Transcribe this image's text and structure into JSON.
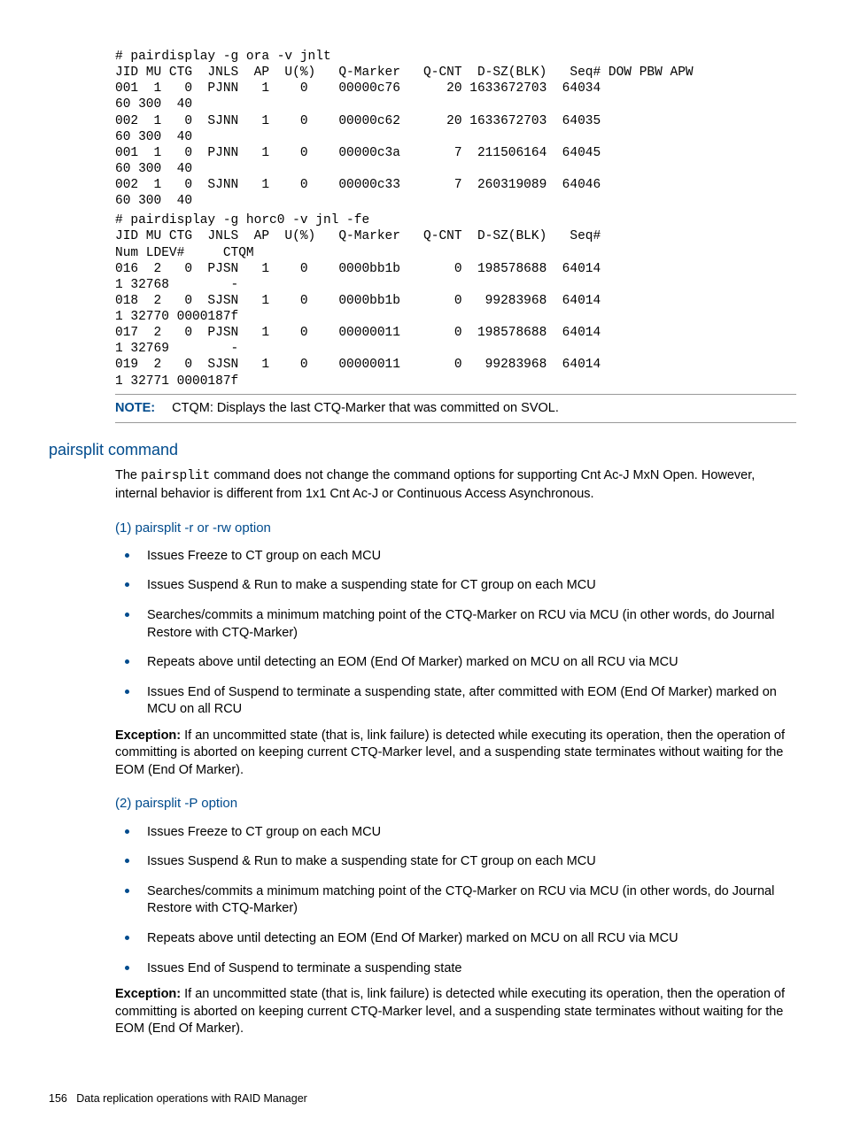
{
  "codeblock1": "# pairdisplay -g ora -v jnlt\nJID MU CTG  JNLS  AP  U(%)   Q-Marker   Q-CNT  D-SZ(BLK)   Seq# DOW PBW APW\n001  1   0  PJNN   1    0    00000c76      20 1633672703  64034\n60 300  40\n002  1   0  SJNN   1    0    00000c62      20 1633672703  64035\n60 300  40\n001  1   0  PJNN   1    0    00000c3a       7  211506164  64045\n60 300  40\n002  1   0  SJNN   1    0    00000c33       7  260319089  64046\n60 300  40",
  "codeblock2": "# pairdisplay -g horc0 -v jnl -fe\nJID MU CTG  JNLS  AP  U(%)   Q-Marker   Q-CNT  D-SZ(BLK)   Seq#\nNum LDEV#     CTQM\n016  2   0  PJSN   1    0    0000bb1b       0  198578688  64014\n1 32768        -\n018  2   0  SJSN   1    0    0000bb1b       0   99283968  64014\n1 32770 0000187f\n017  2   0  PJSN   1    0    00000011       0  198578688  64014\n1 32769        -\n019  2   0  SJSN   1    0    00000011       0   99283968  64014\n1 32771 0000187f",
  "note": {
    "label": "NOTE:",
    "text": "CTQM: Displays the last CTQ-Marker that was committed on SVOL."
  },
  "section": {
    "title": "pairsplit command",
    "intro_pre": "The ",
    "intro_cmd": "pairsplit",
    "intro_post": " command does not change the command options for supporting Cnt Ac-J MxN Open. However, internal behavior is different from 1x1 Cnt Ac-J or Continuous Access Asynchronous."
  },
  "sub1": {
    "title": "(1) pairsplit -r or -rw option",
    "items": [
      "Issues Freeze to CT group on each MCU",
      "Issues Suspend & Run to make a suspending state for CT group on each MCU",
      "Searches/commits a minimum matching point of the CTQ-Marker on RCU via MCU (in other words, do Journal Restore with CTQ-Marker)",
      "Repeats above until detecting an EOM (End Of Marker) marked on MCU on all RCU via MCU",
      "Issues End of Suspend to terminate a suspending state, after committed with EOM (End Of Marker) marked on MCU on all RCU"
    ],
    "exception_label": "Exception:",
    "exception_text": " If an uncommitted state (that is, link failure) is detected while executing its operation, then the operation of committing is aborted on keeping current CTQ-Marker level, and a suspending state terminates without waiting for the EOM (End Of Marker)."
  },
  "sub2": {
    "title": "(2) pairsplit -P option",
    "items": [
      "Issues Freeze to CT group on each MCU",
      "Issues Suspend & Run to make a suspending state for CT group on each MCU",
      "Searches/commits a minimum matching point of the CTQ-Marker on RCU via MCU (in other words, do Journal Restore with CTQ-Marker)",
      "Repeats above until detecting an EOM (End Of Marker) marked on MCU on all RCU via MCU",
      "Issues End of Suspend to terminate a suspending state"
    ],
    "exception_label": "Exception:",
    "exception_text": " If an uncommitted state (that is, link failure) is detected while executing its operation, then the operation of committing is aborted on keeping current CTQ-Marker level, and a suspending state terminates without waiting for the EOM (End Of Marker)."
  },
  "footer": {
    "page": "156",
    "title": "Data replication operations with RAID Manager"
  }
}
